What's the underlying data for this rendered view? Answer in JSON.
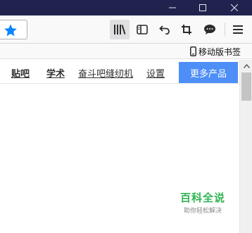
{
  "toolbar": {
    "icons": [
      "star-icon",
      "library-icon",
      "sidebar-icon",
      "back-icon",
      "crop-icon",
      "chat-icon",
      "menu-icon"
    ],
    "accent": "#0a84ff"
  },
  "bookmarks": {
    "mobile_label": "移动版书签"
  },
  "nav": {
    "links": [
      "贴吧",
      "学术",
      "奋斗吧缝纫机",
      "设置"
    ],
    "more_button": "更多产品",
    "button_color": "#4e8ef7"
  },
  "watermark": {
    "title": "百科全说",
    "subtitle": "助你轻松解决"
  }
}
